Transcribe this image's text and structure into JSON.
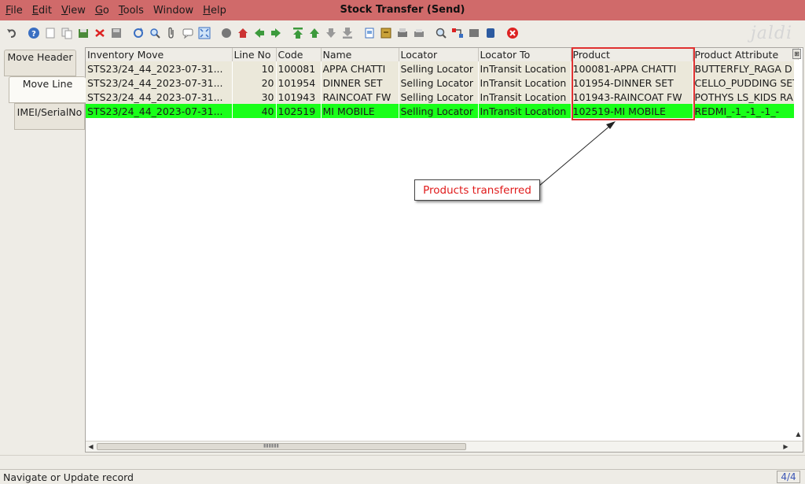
{
  "window": {
    "title": "Stock Transfer (Send)"
  },
  "menu": [
    {
      "label": "File",
      "underline": "F",
      "rest": "ile"
    },
    {
      "label": "Edit",
      "underline": "E",
      "rest": "dit"
    },
    {
      "label": "View",
      "underline": "V",
      "rest": "iew"
    },
    {
      "label": "Go",
      "underline": "G",
      "rest": "o"
    },
    {
      "label": "Tools",
      "underline": "T",
      "rest": "ools"
    },
    {
      "label": "Window",
      "underline": "",
      "rest": "Window"
    },
    {
      "label": "Help",
      "underline": "H",
      "rest": "elp"
    }
  ],
  "logo": "jaldi",
  "tabs": {
    "move_header": "Move Header",
    "move_line": "Move Line",
    "imei": "IMEI/SerialNo"
  },
  "table": {
    "columns": [
      "Inventory Move",
      "Line No",
      "Code",
      "Name",
      "Locator",
      "Locator To",
      "Product",
      "Product Attribute"
    ],
    "rows": [
      {
        "move": "STS23/24_44_2023-07-31...",
        "line": "10",
        "code": "100081",
        "name": "APPA CHATTI",
        "locator": "Selling Locator",
        "locator_to": "InTransit Location",
        "product": "100081-APPA CHATTI",
        "attr": "BUTTERFLY_RAGA D"
      },
      {
        "move": "STS23/24_44_2023-07-31...",
        "line": "20",
        "code": "101954",
        "name": "DINNER SET",
        "locator": "Selling Locator",
        "locator_to": "InTransit Location",
        "product": "101954-DINNER SET",
        "attr": "CELLO_PUDDING SET"
      },
      {
        "move": "STS23/24_44_2023-07-31...",
        "line": "30",
        "code": "101943",
        "name": "RAINCOAT FW",
        "locator": "Selling Locator",
        "locator_to": "InTransit Location",
        "product": "101943-RAINCOAT FW",
        "attr": "POTHYS LS_KIDS RA"
      },
      {
        "move": "STS23/24_44_2023-07-31...",
        "line": "40",
        "code": "102519",
        "name": "MI MOBILE",
        "locator": "Selling Locator",
        "locator_to": "InTransit Location",
        "product": "102519-MI MOBILE",
        "attr": "REDMI_-1_-1_-1_-"
      }
    ]
  },
  "annotation": {
    "callout": "Products transferred"
  },
  "status": {
    "message": "Navigate or Update record",
    "record_count": "4/4"
  },
  "colors": {
    "menubar": "#d06a6a",
    "selected_row": "#19ff19",
    "highlight": "#e03030",
    "callout_text": "#e01a1a"
  }
}
